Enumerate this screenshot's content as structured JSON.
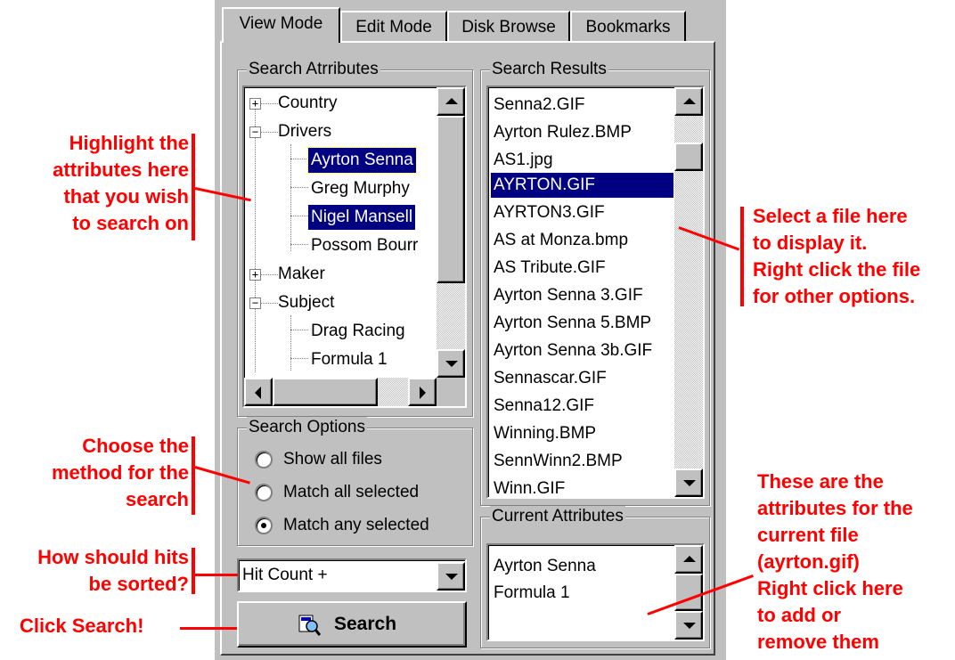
{
  "tabs": [
    "View Mode",
    "Edit Mode",
    "Disk Browse",
    "Bookmarks"
  ],
  "search_attributes": {
    "title": "Search Atrributes",
    "tree": [
      {
        "label": "Country",
        "expander": "+"
      },
      {
        "label": "Drivers",
        "expander": "−"
      },
      {
        "label": "Ayrton Senna",
        "selected": true
      },
      {
        "label": "Greg Murphy"
      },
      {
        "label": "Nigel Mansell",
        "selected": true
      },
      {
        "label": "Possom Bourr"
      },
      {
        "label": "Maker",
        "expander": "+"
      },
      {
        "label": "Subject",
        "expander": "−"
      },
      {
        "label": "Drag Racing"
      },
      {
        "label": "Formula 1"
      }
    ]
  },
  "search_options": {
    "title": "Search Options",
    "options": [
      "Show all files",
      "Match all selected",
      "Match any selected"
    ],
    "selected": "Match any selected"
  },
  "sort": {
    "value": "Hit Count +"
  },
  "search_button": {
    "label": "Search"
  },
  "search_results": {
    "title": "Search Results",
    "files": [
      "Senna2.GIF",
      "Ayrton Rulez.BMP",
      "AS1.jpg",
      "AYRTON.GIF",
      "AYRTON3.GIF",
      "AS at Monza.bmp",
      "AS Tribute.GIF",
      "Ayrton Senna 3.GIF",
      "Ayrton Senna 5.BMP",
      "Ayrton Senna 3b.GIF",
      "Sennascar.GIF",
      "Senna12.GIF",
      "Winning.BMP",
      "SennWinn2.BMP",
      "Winn.GIF"
    ],
    "selected": "AYRTON.GIF"
  },
  "current_attributes": {
    "title": "Current Attributes",
    "items": [
      "Ayrton Senna",
      "Formula 1"
    ]
  },
  "annotations": {
    "highlight": "Highlight the\nattributes here\nthat you wish\nto search on",
    "choose": "Choose the\nmethod for the\nsearch",
    "sorted": "How should hits\nbe sorted?",
    "click": "Click Search!",
    "select": "Select a file here\nto display it.\nRight click the file\nfor other options.",
    "current": "These are the\nattributes for the\ncurrent file\n(ayrton.gif)\nRight click here\nto add or\nremove them"
  },
  "colors": {
    "annotation": "#ff0000",
    "selection": "#000080",
    "face": "#c0c0c0"
  }
}
